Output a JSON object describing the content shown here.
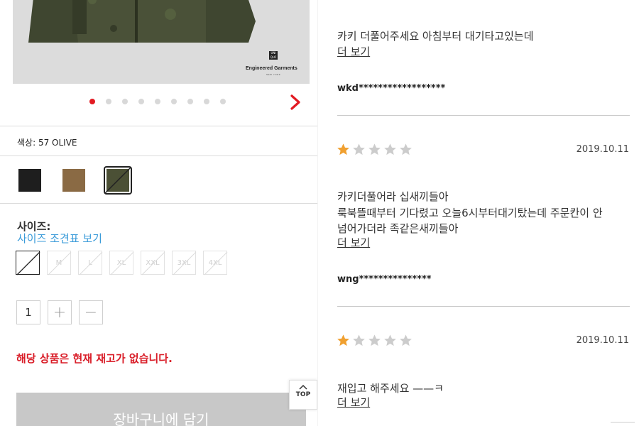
{
  "product": {
    "brand_logo": "UNI QLO",
    "brand_name": "Engineered Garments",
    "brand_sub": "NEW YORK",
    "carousel_total": 9,
    "carousel_active": 1,
    "color_label": "색상: 57 OLIVE",
    "swatches": [
      {
        "name": "black",
        "color": "#1e1e1e",
        "selected": false
      },
      {
        "name": "brown",
        "color": "#8a6a44",
        "selected": false
      },
      {
        "name": "olive",
        "color": "#4b5035",
        "selected": true,
        "sold_out": true
      }
    ],
    "size_title": "사이즈:",
    "size_chart_link": "사이즈 조견표 보기",
    "sizes": [
      "",
      "M",
      "L",
      "XL",
      "XXL",
      "3XL",
      "4XL"
    ],
    "quantity": "1",
    "plus_label": "+",
    "minus_label": "−",
    "stock_message": "해당 상품은 현재 재고가 없습니다.",
    "cart_button": "장바구니에 담기",
    "top_button": "TOP"
  },
  "reviews": {
    "top_partial": {
      "text": "카키 더풀어주세요 아침부터 대기타고있는데",
      "more": "더 보기",
      "user": "wkd******************"
    },
    "items": [
      {
        "rating": 1,
        "date": "2019.10.11",
        "lines": [
          "카키더풀어라 십새끼들아",
          "룩북뜰때부터 기다렸고 오늘6시부터대기탔는데 주문칸이 안",
          "넘어가더라 족같은새끼들아"
        ],
        "more": "더 보기",
        "user": "wng***************"
      },
      {
        "rating": 1,
        "date": "2019.10.11",
        "lines": [
          "재입고 해주세요 ——ㅋ"
        ],
        "more": "더 보기"
      }
    ]
  },
  "colors": {
    "accent_red": "#e21a22",
    "link_blue": "#3a9bd9",
    "star_filled": "#f0a030",
    "star_empty": "#cccccc"
  }
}
